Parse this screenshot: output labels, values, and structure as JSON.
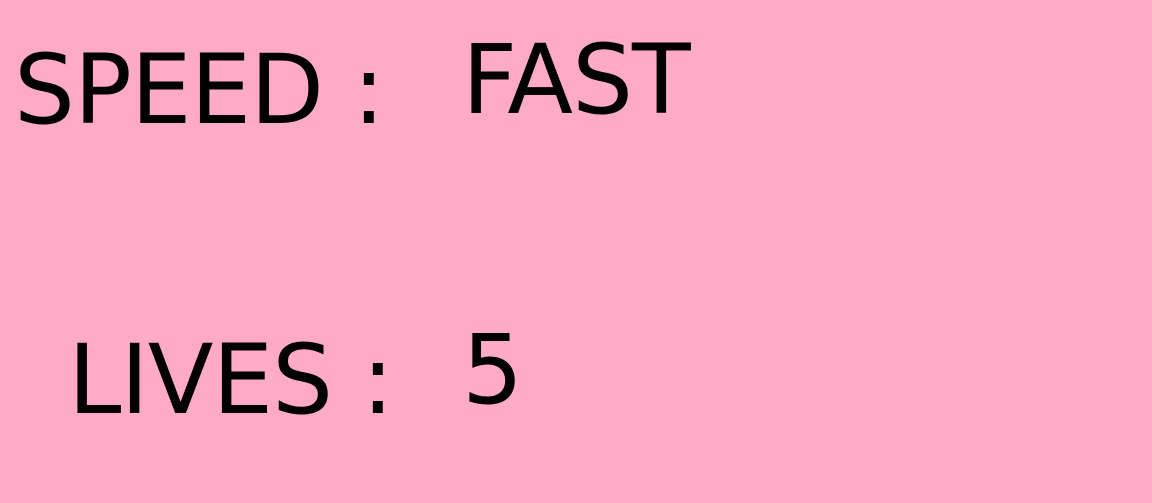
{
  "stats": {
    "speed": {
      "label": "SPEED :",
      "value": "FAST"
    },
    "lives": {
      "label": "LIVES :",
      "value": "5"
    }
  },
  "colors": {
    "background": "#FFABC8",
    "text": "#000000"
  }
}
